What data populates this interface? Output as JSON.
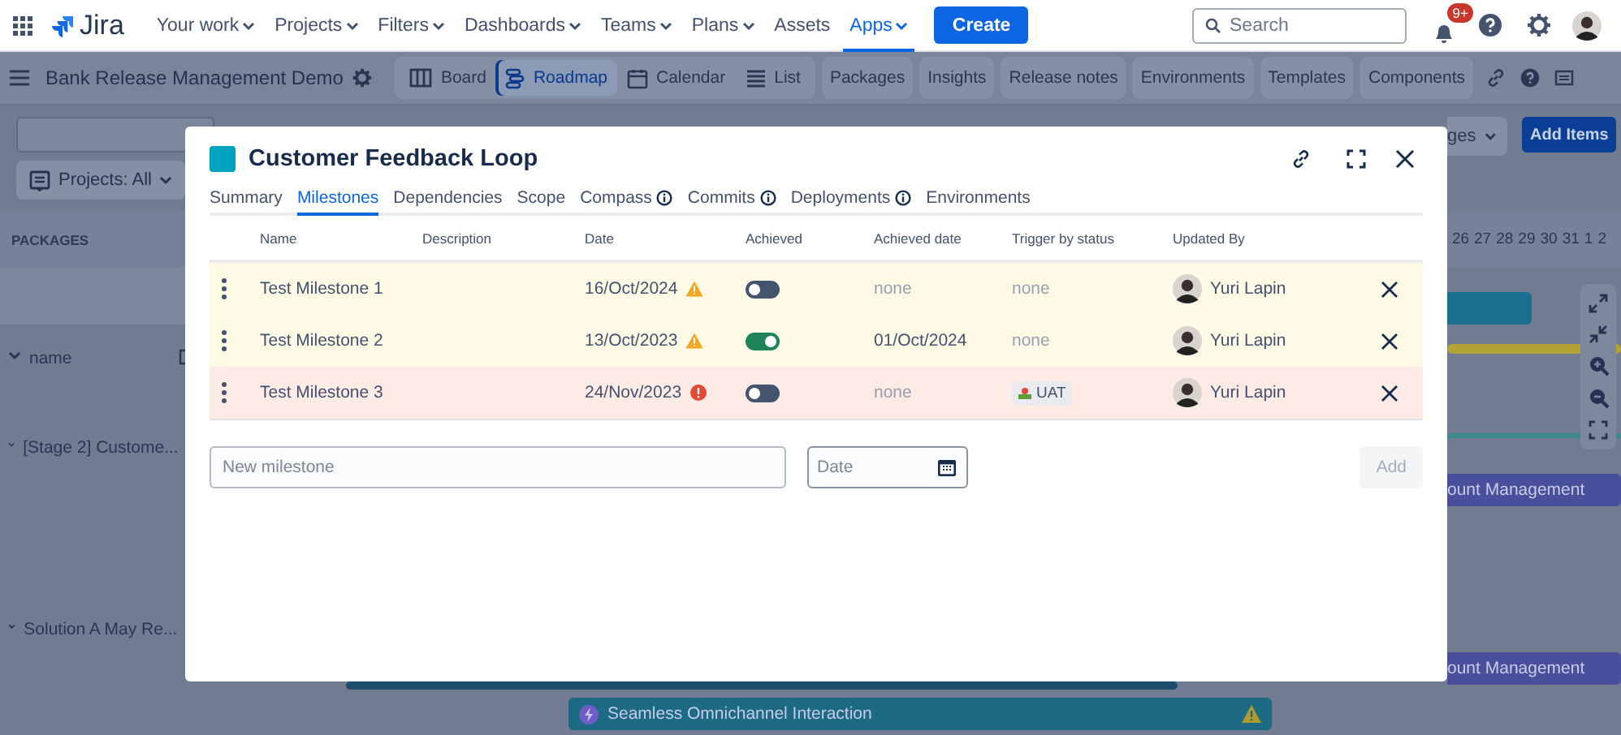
{
  "top_nav": {
    "product": "Jira",
    "items": [
      {
        "label": "Your work",
        "dropdown": true,
        "selected": false
      },
      {
        "label": "Projects",
        "dropdown": true,
        "selected": false
      },
      {
        "label": "Filters",
        "dropdown": true,
        "selected": false
      },
      {
        "label": "Dashboards",
        "dropdown": true,
        "selected": false
      },
      {
        "label": "Teams",
        "dropdown": true,
        "selected": false
      },
      {
        "label": "Plans",
        "dropdown": true,
        "selected": false
      },
      {
        "label": "Assets",
        "dropdown": false,
        "selected": false
      },
      {
        "label": "Apps",
        "dropdown": true,
        "selected": true
      }
    ],
    "create_button": "Create",
    "search": {
      "placeholder": "Search"
    },
    "notifications_badge": "9+"
  },
  "project_bar": {
    "title": "Bank Release Management Demo",
    "view_tabs": [
      {
        "label": "Board",
        "selected": false
      },
      {
        "label": "Roadmap",
        "selected": true
      },
      {
        "label": "Calendar",
        "selected": false
      },
      {
        "label": "List",
        "selected": false
      }
    ],
    "links": [
      "Packages",
      "Insights",
      "Release notes",
      "Environments",
      "Templates",
      "Components"
    ]
  },
  "toolbar": {
    "projects_filter": "Projects: All",
    "dropdown_partial": "ges",
    "add_button": "Add Items"
  },
  "packages_panel": {
    "heading": "PACKAGES",
    "rows": [
      "name",
      "[Stage 2] Custome...",
      "Solution A May Re..."
    ]
  },
  "timeline": {
    "days": [
      "26",
      "27",
      "28",
      "29",
      "30",
      "31",
      "1",
      "2"
    ],
    "bars": [
      {
        "color": "#1b6f8c"
      },
      {
        "color": "#b3a336"
      },
      {
        "color": "#3b8a86"
      },
      {
        "color": "#4a4f9c",
        "label": "ount Management"
      },
      {
        "color": "#4a4f9c",
        "label": "ount Management"
      },
      {
        "color": "#1d4e6b"
      },
      {
        "color": "#1c6a84",
        "label": "Seamless Omnichannel Interaction",
        "warning": true
      }
    ]
  },
  "modal": {
    "title": "Customer Feedback Loop",
    "tabs": [
      {
        "label": "Summary",
        "info": false,
        "selected": false
      },
      {
        "label": "Milestones",
        "info": false,
        "selected": true
      },
      {
        "label": "Dependencies",
        "info": false,
        "selected": false
      },
      {
        "label": "Scope",
        "info": false,
        "selected": false
      },
      {
        "label": "Compass",
        "info": true,
        "selected": false
      },
      {
        "label": "Commits",
        "info": true,
        "selected": false
      },
      {
        "label": "Deployments",
        "info": true,
        "selected": false
      },
      {
        "label": "Environments",
        "info": false,
        "selected": false
      }
    ],
    "table": {
      "columns": [
        "Name",
        "Description",
        "Date",
        "Achieved",
        "Achieved date",
        "Trigger by status",
        "Updated By"
      ],
      "rows": [
        {
          "name": "Test Milestone 1",
          "date": "16/Oct/2024",
          "kind": "warning",
          "achieved": false,
          "achieved_date": "none",
          "trigger": {
            "kind": "text",
            "label": "none"
          },
          "updated_by": "Yuri Lapin"
        },
        {
          "name": "Test Milestone 2",
          "date": "13/Oct/2023",
          "kind": "warning",
          "achieved": true,
          "achieved_date": "01/Oct/2024",
          "trigger": {
            "kind": "text",
            "label": "none"
          },
          "updated_by": "Yuri Lapin"
        },
        {
          "name": "Test Milestone 3",
          "date": "24/Nov/2023",
          "kind": "overdue",
          "achieved": false,
          "achieved_date": "none",
          "trigger": {
            "kind": "status",
            "label": "UAT"
          },
          "updated_by": "Yuri Lapin"
        }
      ]
    },
    "form": {
      "name_placeholder": "New milestone",
      "date_placeholder": "Date",
      "add_button": "Add",
      "add_disabled": true
    }
  }
}
